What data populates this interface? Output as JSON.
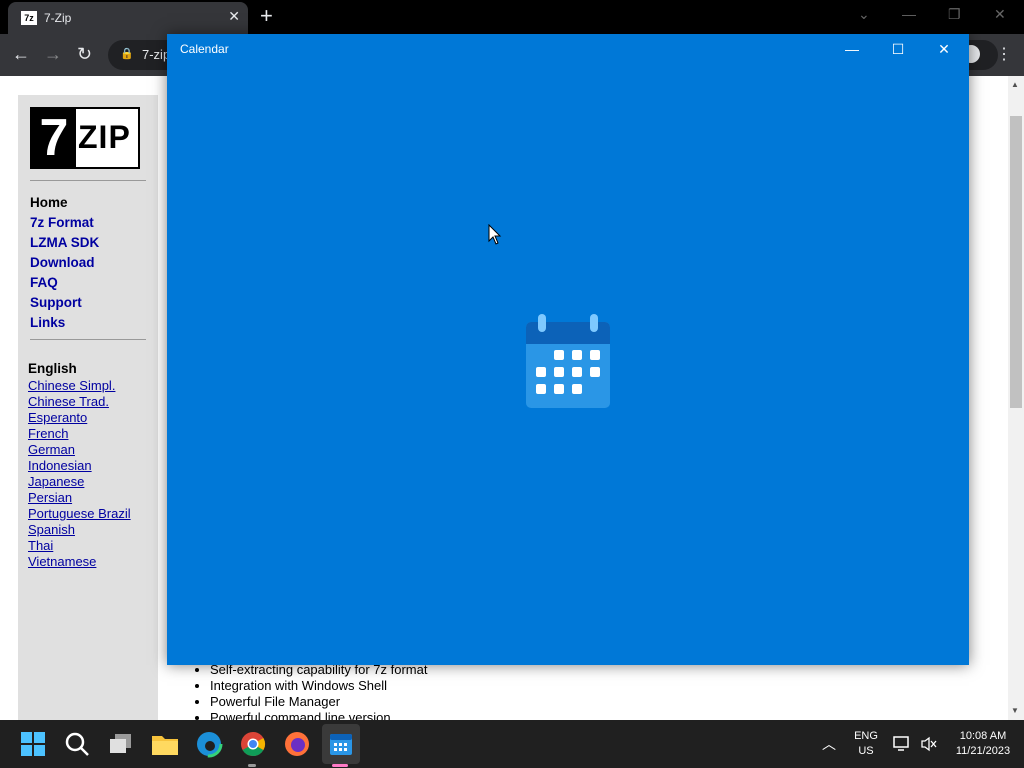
{
  "browser": {
    "tab_title": "7-Zip",
    "tab_favicon": "7z",
    "url_text": "7-zip",
    "icons": [
      "back-icon",
      "forward-icon",
      "reload-icon",
      "lock-icon",
      "profile-icon",
      "menu-icon"
    ]
  },
  "site": {
    "logo_seven": "7",
    "logo_zip": "ZIP",
    "menu": [
      "Home",
      "7z Format",
      "LZMA SDK",
      "Download",
      "FAQ",
      "Support",
      "Links"
    ],
    "language_heading": "English",
    "languages": [
      "Chinese Simpl.",
      "Chinese Trad.",
      "Esperanto",
      "French",
      "German",
      "Indonesian",
      "Japanese",
      "Persian",
      "Portuguese Brazil",
      "Spanish",
      "Thai",
      "Vietnamese"
    ],
    "features": [
      "Self-extracting capability for 7z format",
      "Integration with Windows Shell",
      "Powerful File Manager",
      "Powerful command line version"
    ]
  },
  "calendar_window": {
    "title": "Calendar",
    "background": "#0078d7"
  },
  "taskbar": {
    "language_line1": "ENG",
    "language_line2": "US",
    "time": "10:08 AM",
    "date": "11/21/2023",
    "apps": [
      "start-icon",
      "search-icon",
      "task-view-icon",
      "file-explorer-icon",
      "edge-icon",
      "chrome-icon",
      "firefox-icon",
      "calendar-icon"
    ]
  }
}
